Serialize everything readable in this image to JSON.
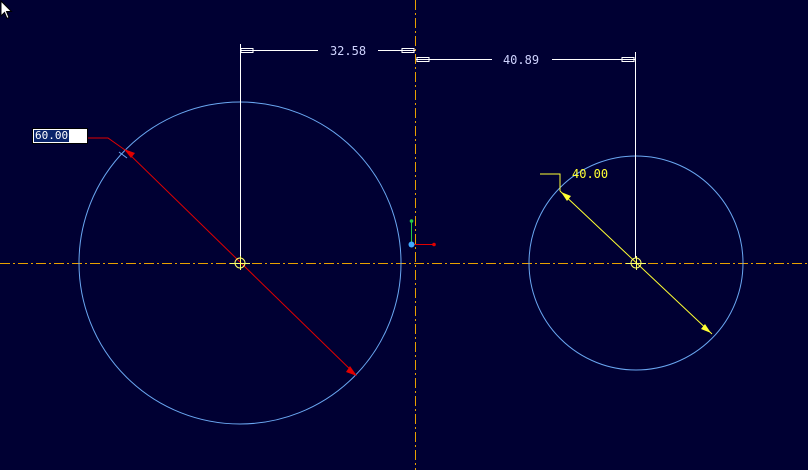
{
  "colors": {
    "background": "#000033",
    "geometry": "#6aa7f2",
    "centerline": "#e8a000",
    "reference": "#ffffff",
    "dimension_text": "#cfd3ff",
    "selected_dimension": "#e00000",
    "active_dimension": "#ffff33"
  },
  "dimensions": {
    "horizontal_left": "32.58",
    "horizontal_right": "40.89",
    "diameter_right": "40.00"
  },
  "edit_field": {
    "value": "60.00"
  },
  "icons": {
    "cursor": "arrow-pointer-icon",
    "csys": "coordinate-system-icon",
    "center_marker": "circle-center-marker-icon"
  }
}
